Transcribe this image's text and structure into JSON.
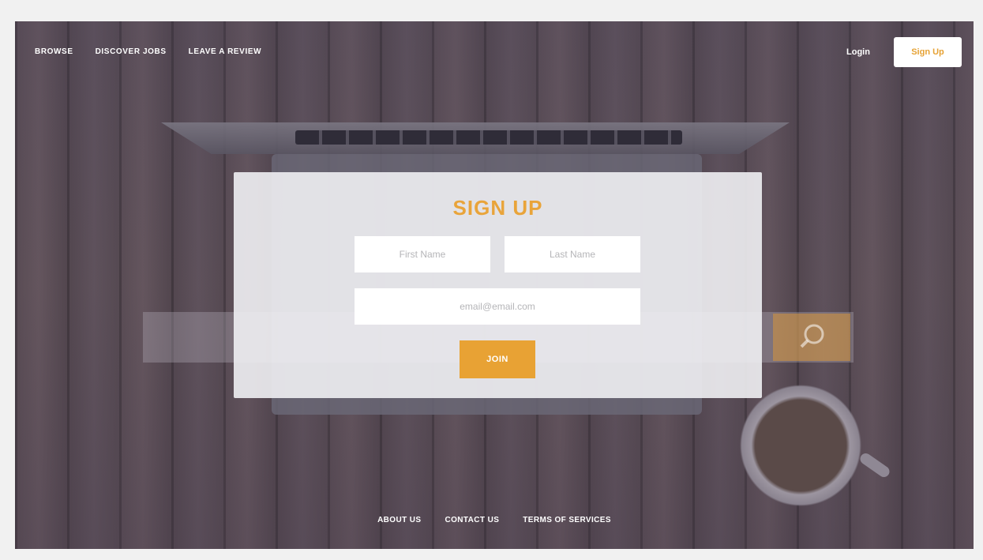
{
  "nav": {
    "links": [
      "BROWSE",
      "DISCOVER JOBS",
      "LEAVE A REVIEW"
    ],
    "login_label": "Login",
    "signup_label": "Sign Up"
  },
  "signup_form": {
    "title": "SIGN UP",
    "first_name_placeholder": "First Name",
    "last_name_placeholder": "Last Name",
    "email_placeholder": "email@email.com",
    "join_label": "JOIN"
  },
  "footer": {
    "links": [
      "ABOUT US",
      "CONTACT US",
      "TERMS OF SERVICES"
    ]
  },
  "colors": {
    "accent": "#e8a234",
    "modal_background": "#f0f0f3",
    "text_light": "#ffffff"
  }
}
